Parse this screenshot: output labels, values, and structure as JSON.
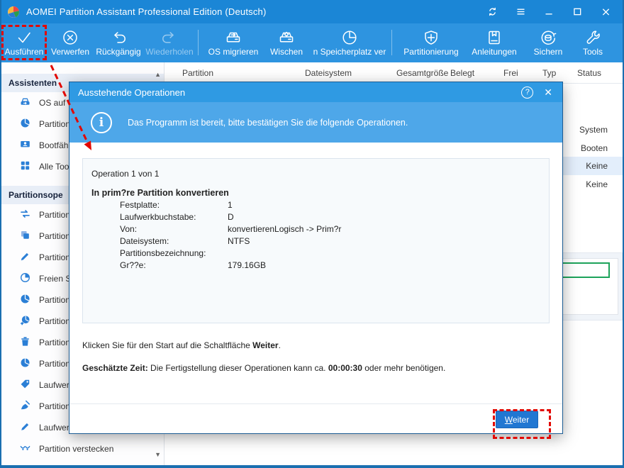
{
  "titlebar": {
    "title": "AOMEI Partition Assistant Professional Edition (Deutsch)",
    "window_controls": [
      "refresh",
      "menu",
      "minimize",
      "maximize",
      "close"
    ]
  },
  "toolbar": {
    "groups": [
      [
        {
          "name": "execute",
          "icon": "check",
          "label": "Ausführen",
          "highlighted": true
        },
        {
          "name": "discard",
          "icon": "discard",
          "label": "Verwerfen"
        },
        {
          "name": "undo",
          "icon": "undo",
          "label": "Rückgängig"
        },
        {
          "name": "redo",
          "icon": "redo",
          "label": "Wiederholen",
          "disabled": true
        }
      ],
      [
        {
          "name": "migrate-os",
          "icon": "disk-arrow",
          "label": "OS migrieren"
        },
        {
          "name": "wipe",
          "icon": "disk-wipe",
          "label": "Wischen"
        },
        {
          "name": "allocate-space",
          "icon": "pie-clock",
          "label": "n Speicherplatz ver"
        }
      ],
      [
        {
          "name": "partitioning",
          "icon": "shield-plus",
          "label": "Partitionierung"
        },
        {
          "name": "guides",
          "icon": "book",
          "label": "Anleitungen"
        },
        {
          "name": "backup",
          "icon": "db-sync",
          "label": "Sichern"
        },
        {
          "name": "tools",
          "icon": "wrench",
          "label": "Tools"
        }
      ]
    ]
  },
  "sidebar": {
    "scroll_up": "▲",
    "scroll_down": "▼",
    "sections": [
      {
        "header": "Assistenten",
        "items": [
          {
            "icon": "disk-arrow-mini",
            "label": "OS auf S"
          },
          {
            "icon": "pie",
            "label": "Partition"
          },
          {
            "icon": "boot-media",
            "label": "Bootfähig"
          },
          {
            "icon": "grid",
            "label": "Alle Tools"
          }
        ]
      },
      {
        "header": "Partitionsope",
        "items": [
          {
            "icon": "convert-arrows",
            "label": "Partitions"
          },
          {
            "icon": "copy",
            "label": "Partitione"
          },
          {
            "icon": "pen",
            "label": "Partition"
          },
          {
            "icon": "clock-pie",
            "label": "Freien Sp"
          },
          {
            "icon": "pie",
            "label": "Partition"
          },
          {
            "icon": "pie-plus",
            "label": "Partition"
          },
          {
            "icon": "trash",
            "label": "Partition"
          },
          {
            "icon": "pie",
            "label": "Partition"
          },
          {
            "icon": "tag",
            "label": "Laufwerk"
          },
          {
            "icon": "broom",
            "label": "Partition"
          },
          {
            "icon": "pencil",
            "label": "Laufwerk"
          },
          {
            "icon": "hide-eye",
            "label": "Partition verstecken"
          }
        ]
      }
    ]
  },
  "table": {
    "headers": [
      "Partition",
      "Dateisystem",
      "Gesamtgröße",
      "Belegt",
      "Frei",
      "Typ",
      "Status"
    ],
    "status_values": [
      "System",
      "Booten",
      "Keine",
      "Keine"
    ],
    "selected_status_index": 2
  },
  "dialog": {
    "title": "Ausstehende Operationen",
    "help_label": "?",
    "close_label": "✕",
    "info": "Das Programm ist bereit, bitte bestätigen Sie die folgende Operationen.",
    "operation_header": "Operation 1 von 1",
    "operation_title": "In prim?re Partition konvertieren",
    "details": [
      {
        "label": "Festplatte:",
        "value": "1"
      },
      {
        "label": "Laufwerkbuchstabe:",
        "value": "D"
      },
      {
        "label": "Von:",
        "value": "konvertierenLogisch -> Prim?r"
      },
      {
        "label": "Dateisystem:",
        "value": "NTFS"
      },
      {
        "label": "Partitionsbezeichnung:",
        "value": ""
      },
      {
        "label": "Gr??e:",
        "value": "179.16GB"
      }
    ],
    "instruction": {
      "pre": "Klicken Sie für den Start auf die Schaltfläche ",
      "bold": "Weiter",
      "post": "."
    },
    "estimate": {
      "label": "Geschätzte Zeit:",
      "text1": " Die Fertigstellung dieser Operationen kann ca. ",
      "time": "00:00:30",
      "text2": " oder mehr benötigen."
    },
    "next_button": "Weiter"
  },
  "colors": {
    "titlebar": "#1b86d6",
    "toolbar": "#2e94e0",
    "dialog_header": "#2f9ae3",
    "banner": "#4ea7e9",
    "button": "#2177d2",
    "annotation_red": "#e20800",
    "partition_green": "#1da35a"
  }
}
